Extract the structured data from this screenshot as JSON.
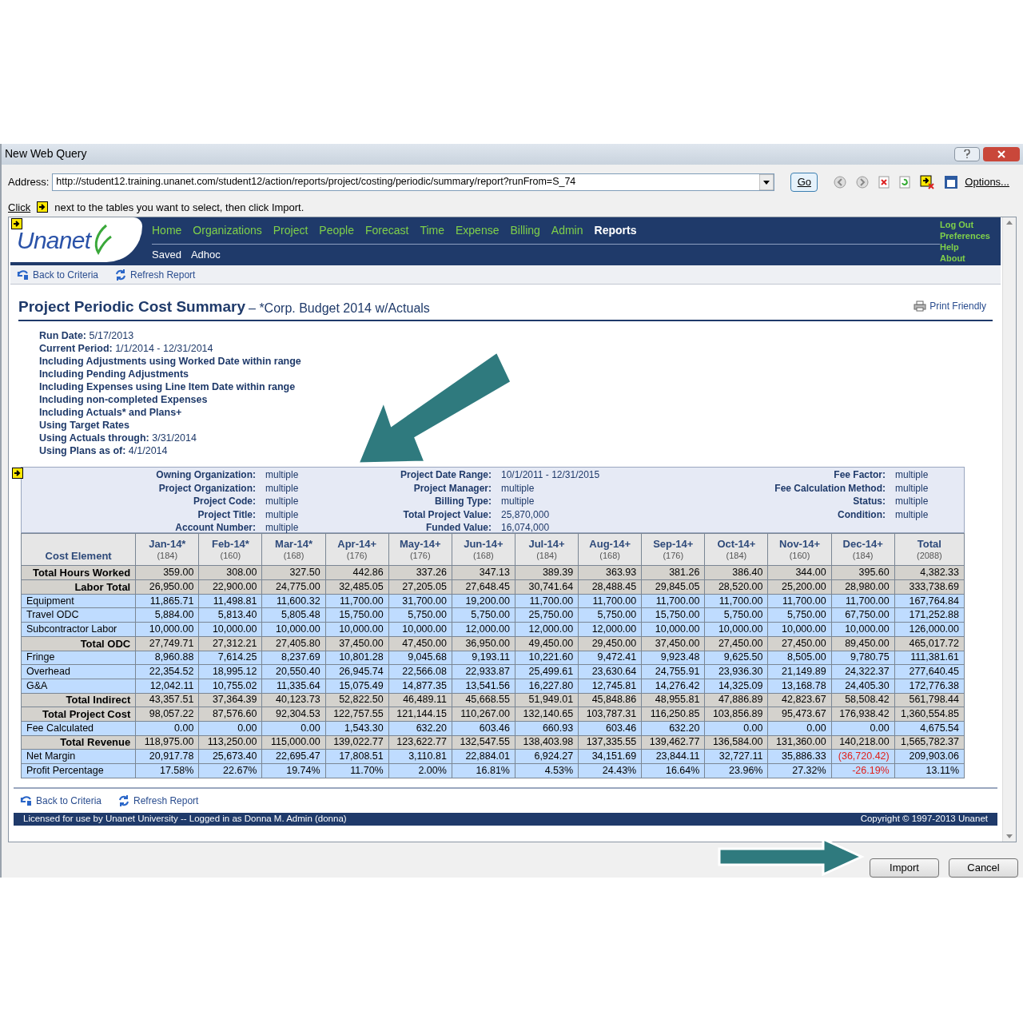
{
  "window": {
    "title": "New Web Query"
  },
  "address": {
    "label": "Address:",
    "value": "http://student12.training.unanet.com/student12/action/reports/project/costing/periodic/summary/report?runFrom=S_74"
  },
  "go_button": "Go",
  "options_label": "Options...",
  "instruction": {
    "before": "Click",
    "after": "next to the tables you want to select, then click Import."
  },
  "nav": {
    "logo_text": "Unanet",
    "menu": [
      {
        "label": "Home",
        "selected": false
      },
      {
        "label": "Organizations",
        "selected": false
      },
      {
        "label": "Project",
        "selected": false
      },
      {
        "label": "People",
        "selected": false
      },
      {
        "label": "Forecast",
        "selected": false
      },
      {
        "label": "Time",
        "selected": false
      },
      {
        "label": "Expense",
        "selected": false
      },
      {
        "label": "Billing",
        "selected": false
      },
      {
        "label": "Admin",
        "selected": false
      },
      {
        "label": "Reports",
        "selected": true
      }
    ],
    "submenu": [
      "Saved",
      "Adhoc"
    ],
    "user_links": [
      "Log Out",
      "Preferences",
      "Help",
      "About"
    ]
  },
  "actions_top": [
    "Back to Criteria",
    "Refresh Report"
  ],
  "report": {
    "title": "Project Periodic Cost Summary",
    "subtitle": "– *Corp. Budget 2014 w/Actuals",
    "print": "Print Friendly"
  },
  "info": [
    {
      "label": "Run Date:",
      "value": "5/17/2013"
    },
    {
      "label": "Current Period:",
      "value": "1/1/2014 - 12/31/2014"
    },
    {
      "label": "Including Adjustments using Worked Date within range"
    },
    {
      "label": "Including Pending Adjustments"
    },
    {
      "label": "Including Expenses using Line Item Date within range"
    },
    {
      "label": "Including non-completed Expenses"
    },
    {
      "label": "Including Actuals* and Plans+"
    },
    {
      "label": "Using Target Rates"
    },
    {
      "label": "Using Actuals through:",
      "value": "3/31/2014"
    },
    {
      "label": "Using Plans as of:",
      "value": "4/1/2014"
    }
  ],
  "filters": [
    [
      {
        "label": "Owning Organization:",
        "value": "multiple"
      },
      {
        "label": "Project Organization:",
        "value": "multiple"
      },
      {
        "label": "Project Code:",
        "value": "multiple"
      },
      {
        "label": "Project Title:",
        "value": "multiple"
      },
      {
        "label": "Account Number:",
        "value": "multiple"
      }
    ],
    [
      {
        "label": "Project Date Range:",
        "value": "10/1/2011 - 12/31/2015"
      },
      {
        "label": "Project Manager:",
        "value": "multiple"
      },
      {
        "label": "Billing Type:",
        "value": "multiple"
      },
      {
        "label": "Total Project Value:",
        "value": "25,870,000"
      },
      {
        "label": "Funded Value:",
        "value": "16,074,000"
      }
    ],
    [
      {
        "label": "Fee Factor:",
        "value": "multiple"
      },
      {
        "label": "Fee Calculation Method:",
        "value": "multiple"
      },
      {
        "label": "Status:",
        "value": "multiple"
      },
      {
        "label": "Condition:",
        "value": "multiple"
      }
    ]
  ],
  "table": {
    "first_column": "Cost Element",
    "columns": [
      {
        "label": "Jan-14*",
        "hours": "(184)"
      },
      {
        "label": "Feb-14*",
        "hours": "(160)"
      },
      {
        "label": "Mar-14*",
        "hours": "(168)"
      },
      {
        "label": "Apr-14+",
        "hours": "(176)"
      },
      {
        "label": "May-14+",
        "hours": "(176)"
      },
      {
        "label": "Jun-14+",
        "hours": "(168)"
      },
      {
        "label": "Jul-14+",
        "hours": "(184)"
      },
      {
        "label": "Aug-14+",
        "hours": "(168)"
      },
      {
        "label": "Sep-14+",
        "hours": "(176)"
      },
      {
        "label": "Oct-14+",
        "hours": "(184)"
      },
      {
        "label": "Nov-14+",
        "hours": "(160)"
      },
      {
        "label": "Dec-14+",
        "hours": "(184)"
      },
      {
        "label": "Total",
        "hours": "(2088)"
      }
    ],
    "rows": [
      {
        "label": "Total Hours Worked",
        "kind": "total",
        "cells": [
          "359.00",
          "308.00",
          "327.50",
          "442.86",
          "337.26",
          "347.13",
          "389.39",
          "363.93",
          "381.26",
          "386.40",
          "344.00",
          "395.60",
          "4,382.33"
        ]
      },
      {
        "label": "Labor Total",
        "kind": "total",
        "cells": [
          "26,950.00",
          "22,900.00",
          "24,775.00",
          "32,485.05",
          "27,205.05",
          "27,648.45",
          "30,741.64",
          "28,488.45",
          "29,845.05",
          "28,520.00",
          "25,200.00",
          "28,980.00",
          "333,738.69"
        ]
      },
      {
        "label": "Equipment",
        "kind": "detail",
        "cells": [
          "11,865.71",
          "11,498.81",
          "11,600.32",
          "11,700.00",
          "31,700.00",
          "19,200.00",
          "11,700.00",
          "11,700.00",
          "11,700.00",
          "11,700.00",
          "11,700.00",
          "11,700.00",
          "167,764.84"
        ]
      },
      {
        "label": "Travel ODC",
        "kind": "detail",
        "cells": [
          "5,884.00",
          "5,813.40",
          "5,805.48",
          "15,750.00",
          "5,750.00",
          "5,750.00",
          "25,750.00",
          "5,750.00",
          "15,750.00",
          "5,750.00",
          "5,750.00",
          "67,750.00",
          "171,252.88"
        ]
      },
      {
        "label": "Subcontractor Labor",
        "kind": "detail",
        "cells": [
          "10,000.00",
          "10,000.00",
          "10,000.00",
          "10,000.00",
          "10,000.00",
          "12,000.00",
          "12,000.00",
          "12,000.00",
          "10,000.00",
          "10,000.00",
          "10,000.00",
          "10,000.00",
          "126,000.00"
        ]
      },
      {
        "label": "Total ODC",
        "kind": "total",
        "cells": [
          "27,749.71",
          "27,312.21",
          "27,405.80",
          "37,450.00",
          "47,450.00",
          "36,950.00",
          "49,450.00",
          "29,450.00",
          "37,450.00",
          "27,450.00",
          "27,450.00",
          "89,450.00",
          "465,017.72"
        ]
      },
      {
        "label": "Fringe",
        "kind": "detail",
        "cells": [
          "8,960.88",
          "7,614.25",
          "8,237.69",
          "10,801.28",
          "9,045.68",
          "9,193.11",
          "10,221.60",
          "9,472.41",
          "9,923.48",
          "9,625.50",
          "8,505.00",
          "9,780.75",
          "111,381.61"
        ]
      },
      {
        "label": "Overhead",
        "kind": "detail",
        "cells": [
          "22,354.52",
          "18,995.12",
          "20,550.40",
          "26,945.74",
          "22,566.08",
          "22,933.87",
          "25,499.61",
          "23,630.64",
          "24,755.91",
          "23,936.30",
          "21,149.89",
          "24,322.37",
          "277,640.45"
        ]
      },
      {
        "label": "G&A",
        "kind": "detail",
        "cells": [
          "12,042.11",
          "10,755.02",
          "11,335.64",
          "15,075.49",
          "14,877.35",
          "13,541.56",
          "16,227.80",
          "12,745.81",
          "14,276.42",
          "14,325.09",
          "13,168.78",
          "24,405.30",
          "172,776.38"
        ]
      },
      {
        "label": "Total Indirect",
        "kind": "total",
        "cells": [
          "43,357.51",
          "37,364.39",
          "40,123.73",
          "52,822.50",
          "46,489.11",
          "45,668.55",
          "51,949.01",
          "45,848.86",
          "48,955.81",
          "47,886.89",
          "42,823.67",
          "58,508.42",
          "561,798.44"
        ]
      },
      {
        "label": "Total Project Cost",
        "kind": "total",
        "cells": [
          "98,057.22",
          "87,576.60",
          "92,304.53",
          "122,757.55",
          "121,144.15",
          "110,267.00",
          "132,140.65",
          "103,787.31",
          "116,250.85",
          "103,856.89",
          "95,473.67",
          "176,938.42",
          "1,360,554.85"
        ]
      },
      {
        "label": "Fee Calculated",
        "kind": "detail",
        "cells": [
          "0.00",
          "0.00",
          "0.00",
          "1,543.30",
          "632.20",
          "603.46",
          "660.93",
          "603.46",
          "632.20",
          "0.00",
          "0.00",
          "0.00",
          "4,675.54"
        ]
      },
      {
        "label": "Total Revenue",
        "kind": "total",
        "cells": [
          "118,975.00",
          "113,250.00",
          "115,000.00",
          "139,022.77",
          "123,622.77",
          "132,547.55",
          "138,403.98",
          "137,335.55",
          "139,462.77",
          "136,584.00",
          "131,360.00",
          "140,218.00",
          "1,565,782.37"
        ]
      },
      {
        "label": "Net Margin",
        "kind": "detail",
        "negative": [
          false,
          false,
          false,
          false,
          false,
          false,
          false,
          false,
          false,
          false,
          false,
          true,
          false
        ],
        "cells": [
          "20,917.78",
          "25,673.40",
          "22,695.47",
          "17,808.51",
          "3,110.81",
          "22,884.01",
          "6,924.27",
          "34,151.69",
          "23,844.11",
          "32,727.11",
          "35,886.33",
          "(36,720.42)",
          "209,903.06"
        ]
      },
      {
        "label": "Profit Percentage",
        "kind": "detail",
        "negative": [
          false,
          false,
          false,
          false,
          false,
          false,
          false,
          false,
          false,
          false,
          false,
          true,
          false
        ],
        "cells": [
          "17.58%",
          "22.67%",
          "19.74%",
          "11.70%",
          "2.00%",
          "16.81%",
          "4.53%",
          "24.43%",
          "16.64%",
          "23.96%",
          "27.32%",
          "-26.19%",
          "13.11%"
        ]
      }
    ]
  },
  "actions_bottom": [
    "Back to Criteria",
    "Refresh Report"
  ],
  "footer": {
    "license": "Licensed for use by Unanet University -- Logged in as Donna M. Admin (donna)",
    "copyright": "Copyright © 1997-2013 Unanet"
  },
  "buttons": [
    "Import",
    "Cancel"
  ]
}
